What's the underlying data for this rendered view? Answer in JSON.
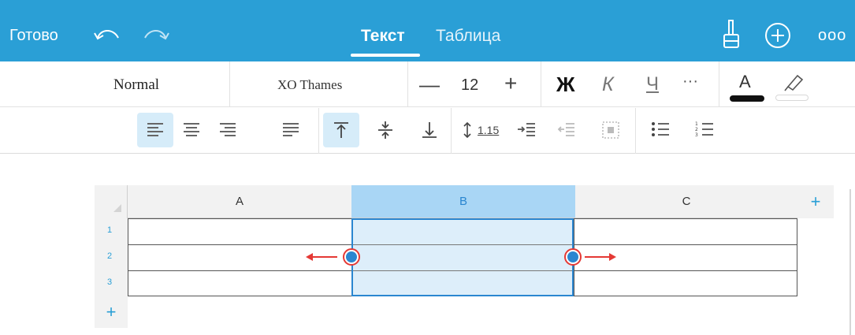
{
  "topbar": {
    "done_label": "Готово",
    "tabs": [
      {
        "label": "Текст",
        "active": true
      },
      {
        "label": "Таблица",
        "active": false
      }
    ],
    "icons": [
      "undo-icon",
      "redo-icon",
      "brush-icon",
      "add-icon",
      "more-icon"
    ],
    "more_label": "ooo"
  },
  "format": {
    "style": "Normal",
    "font": "XO Thames",
    "size_minus": "—",
    "size": "12",
    "size_plus": "+",
    "bold": "Ж",
    "italic": "К",
    "underline": "Ч",
    "more": "···",
    "font_color_letter": "A",
    "line_spacing": "1.15"
  },
  "sheet": {
    "columns": [
      {
        "label": "A",
        "selected": false
      },
      {
        "label": "B",
        "selected": true
      },
      {
        "label": "C",
        "selected": false
      }
    ],
    "rows": [
      "1",
      "2",
      "3"
    ],
    "add_column": "+",
    "add_row": "+"
  },
  "colors": {
    "accent": "#2a9fd6",
    "selection": "#ddeefa",
    "selection_border": "#2a86d0",
    "arrow": "#e53935"
  }
}
